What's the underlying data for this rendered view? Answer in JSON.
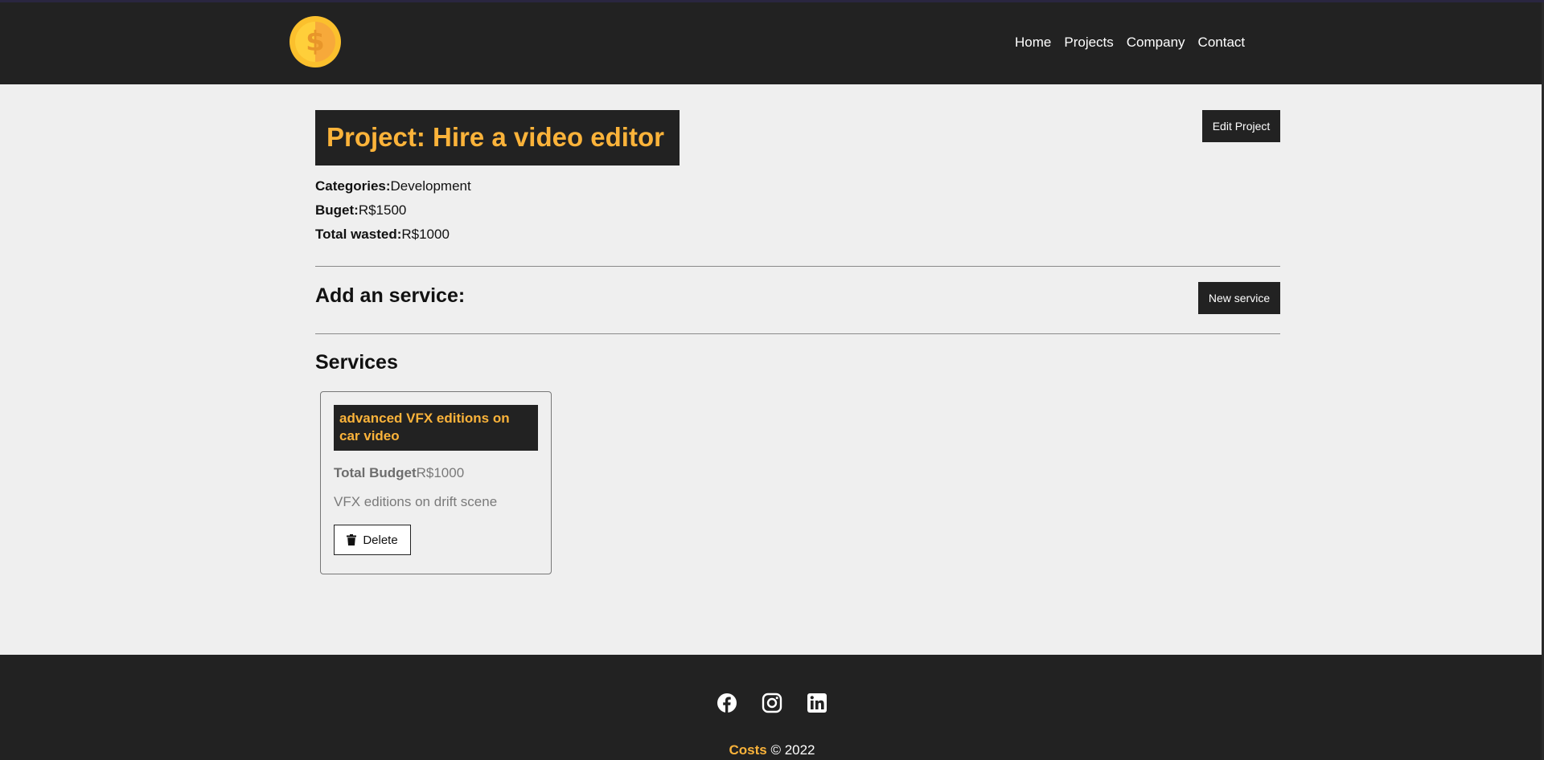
{
  "nav": {
    "logo_icon": "dollar-coin-icon",
    "logo_symbol": "$",
    "links": [
      "Home",
      "Projects",
      "Company",
      "Contact"
    ]
  },
  "project": {
    "title": "Project: Hire a video editor",
    "edit_label": "Edit Project",
    "categories_label": "Categories:",
    "categories_value": "Development",
    "budget_label": "Buget:",
    "budget_value": "R$1500",
    "wasted_label": "Total wasted:",
    "wasted_value": "R$1000"
  },
  "add_service": {
    "title": "Add an service:",
    "button_label": "New service"
  },
  "services": {
    "title": "Services",
    "items": [
      {
        "name": "advanced VFX editions on car video",
        "budget_label": "Total Budget",
        "budget_value": "R$1000",
        "description": "VFX editions on drift scene",
        "delete_label": "Delete",
        "delete_icon": "trash-icon"
      }
    ]
  },
  "footer": {
    "social_icons": [
      "facebook-icon",
      "instagram-icon",
      "linkedin-icon"
    ],
    "brand": "Costs",
    "copyright": " © 2022"
  },
  "colors": {
    "dark": "#222222",
    "accent": "#fbb33a",
    "background": "#efefef"
  }
}
